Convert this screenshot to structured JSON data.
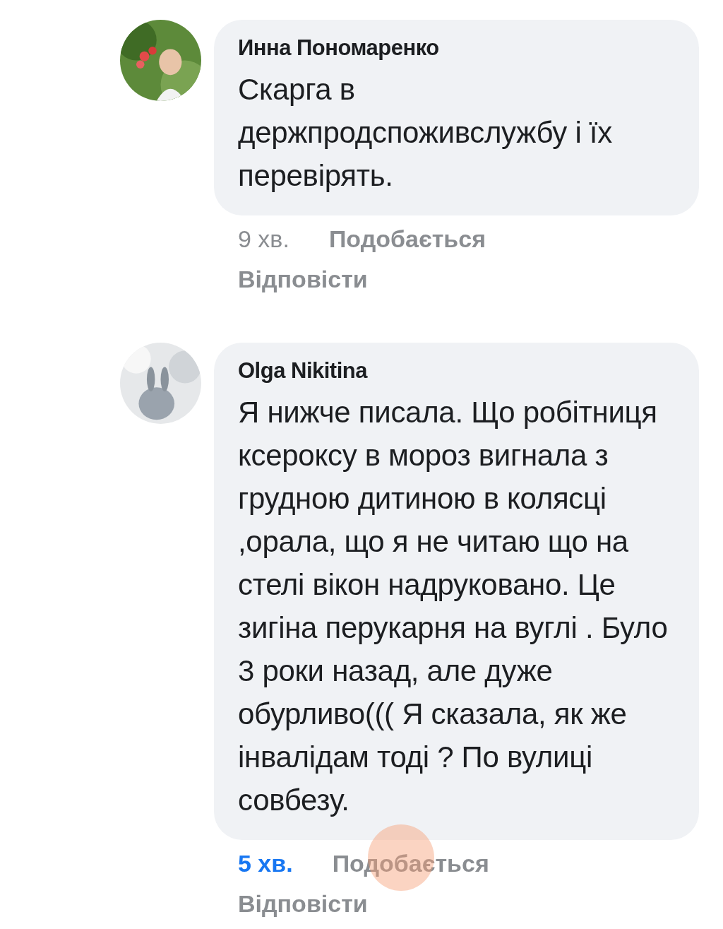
{
  "comments": [
    {
      "author": "Инна Пономаренко",
      "text": "Скарга в держпродспоживслужбу і їх перевірять.",
      "time": "9 хв.",
      "new": false,
      "actions": [
        "Подобається",
        "Відповісти"
      ]
    },
    {
      "author": "Olga Nikitina",
      "text": "Я нижче писала. Що робітниця ксероксу в мороз вигнала з грудною дитиною в колясці  ,орала, що я не читаю що на стелі вікон надруковано. Це зигіна перукарня на вуглі . Було 3 роки назад, але дуже обурливо((( Я сказала, як же інвалідам тоді ? По вулиці совбезу.",
      "time": "5 хв.",
      "new": true,
      "actions": [
        "Подобається",
        "Відповісти"
      ],
      "touch_indicator": true
    }
  ]
}
